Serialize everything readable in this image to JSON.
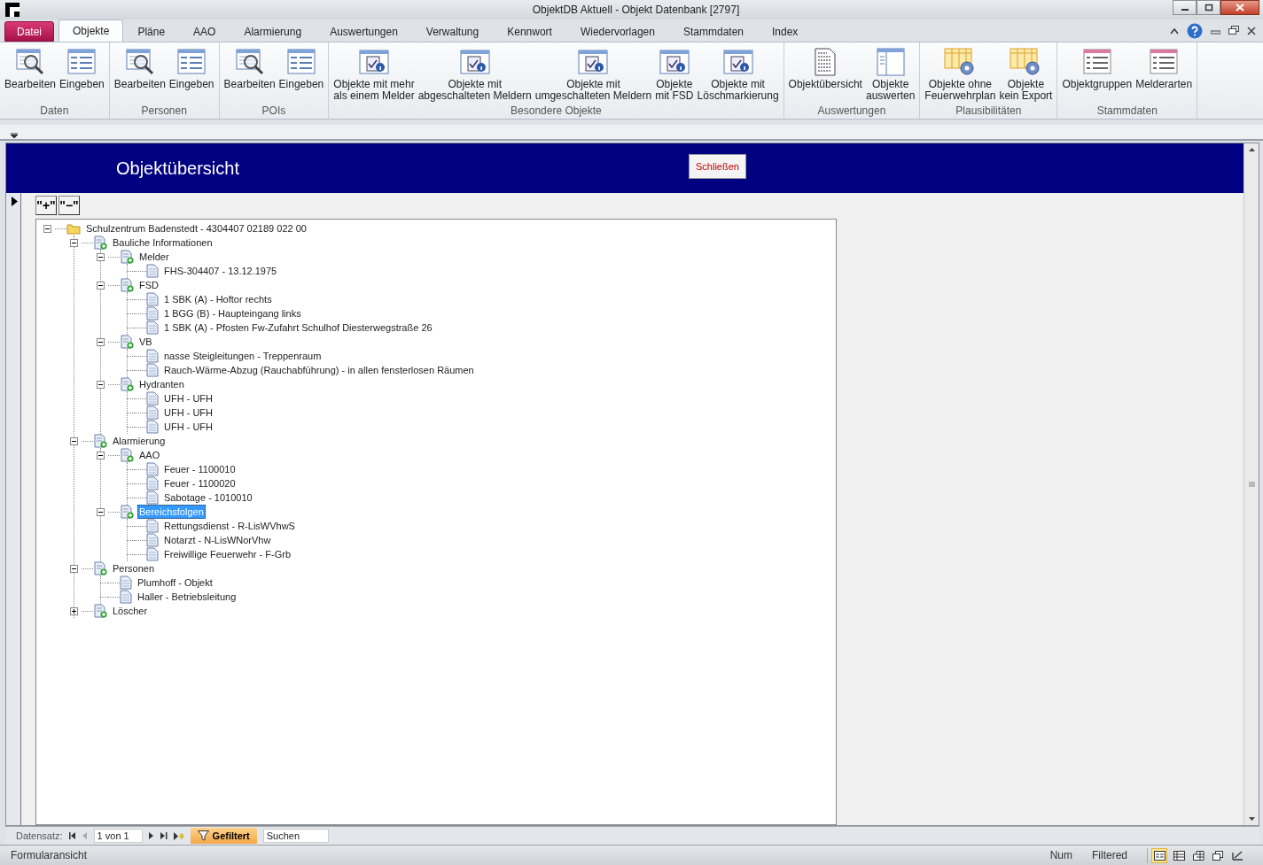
{
  "window": {
    "title": "ObjektDB Aktuell  -  Objekt Datenbank [2797]"
  },
  "file_tab": "Datei",
  "tabs": [
    {
      "label": "Objekte",
      "selected": true
    },
    {
      "label": "Pläne",
      "selected": false
    },
    {
      "label": "AAO",
      "selected": false
    },
    {
      "label": "Alarmierung",
      "selected": false
    },
    {
      "label": "Auswertungen",
      "selected": false
    },
    {
      "label": "Verwaltung",
      "selected": false
    },
    {
      "label": "Kennwort",
      "selected": false
    },
    {
      "label": "Wiedervorlagen",
      "selected": false
    },
    {
      "label": "Stammdaten",
      "selected": false
    },
    {
      "label": "Index",
      "selected": false
    }
  ],
  "ribbon_groups": [
    {
      "label": "Daten",
      "buttons": [
        {
          "label": "Bearbeiten",
          "kind": "search"
        },
        {
          "label": "Eingeben",
          "kind": "form"
        }
      ]
    },
    {
      "label": "Personen",
      "buttons": [
        {
          "label": "Bearbeiten",
          "kind": "search"
        },
        {
          "label": "Eingeben",
          "kind": "form"
        }
      ]
    },
    {
      "label": "POIs",
      "buttons": [
        {
          "label": "Bearbeiten",
          "kind": "search"
        },
        {
          "label": "Eingeben",
          "kind": "form"
        }
      ]
    },
    {
      "label": "Besondere Objekte",
      "buttons": [
        {
          "label": "Objekte mit mehr\nals einem Melder",
          "kind": "query"
        },
        {
          "label": "Objekte mit\nabgeschalteten Meldern",
          "kind": "query"
        },
        {
          "label": "Objekte mit\numgeschalteten Meldern",
          "kind": "query"
        },
        {
          "label": "Objekte\nmit FSD",
          "kind": "query"
        },
        {
          "label": "Objekte mit\nLöschmarkierung",
          "kind": "query"
        }
      ]
    },
    {
      "label": "Auswertungen",
      "buttons": [
        {
          "label": "Objektübersicht",
          "kind": "report"
        },
        {
          "label": "Objekte\nauswerten",
          "kind": "evaluate"
        }
      ]
    },
    {
      "label": "Plausibilitäten",
      "buttons": [
        {
          "label": "Objekte ohne\nFeuerwehrplan",
          "kind": "check"
        },
        {
          "label": "Objekte\nkein Export",
          "kind": "check"
        }
      ]
    },
    {
      "label": "Stammdaten",
      "buttons": [
        {
          "label": "Objektgruppen",
          "kind": "master"
        },
        {
          "label": "Melderarten",
          "kind": "master"
        }
      ]
    }
  ],
  "form": {
    "title": "Objektübersicht",
    "close_button": "Schließen",
    "expand_all_button": "\"+\"",
    "collapse_all_button": "\"−\""
  },
  "tree": [
    {
      "label": "Schulzentrum Badenstedt - 4304407 02189 022 00",
      "kind": "folder",
      "expanded": true,
      "selected": false,
      "children": [
        {
          "label": "Bauliche Informationen",
          "kind": "group",
          "expanded": true,
          "selected": false,
          "children": [
            {
              "label": "Melder",
              "kind": "group",
              "expanded": true,
              "selected": false,
              "children": [
                {
                  "label": "FHS-304407 - 13.12.1975",
                  "kind": "leaf",
                  "selected": false
                }
              ]
            },
            {
              "label": "FSD",
              "kind": "group",
              "expanded": true,
              "selected": false,
              "children": [
                {
                  "label": "1 SBK (A) - Hoftor rechts",
                  "kind": "leaf",
                  "selected": false
                },
                {
                  "label": "1 BGG (B) - Haupteingang links",
                  "kind": "leaf",
                  "selected": false
                },
                {
                  "label": "1 SBK (A) - Pfosten Fw-Zufahrt Schulhof Diesterwegstraße 26",
                  "kind": "leaf",
                  "selected": false
                }
              ]
            },
            {
              "label": "VB",
              "kind": "group",
              "expanded": true,
              "selected": false,
              "children": [
                {
                  "label": "nasse Steigleitungen - Treppenraum",
                  "kind": "leaf",
                  "selected": false
                },
                {
                  "label": "Rauch-Wärme-Abzug (Rauchabführung) - in allen fensterlosen Räumen",
                  "kind": "leaf",
                  "selected": false
                }
              ]
            },
            {
              "label": "Hydranten",
              "kind": "group",
              "expanded": true,
              "selected": false,
              "children": [
                {
                  "label": "UFH - UFH",
                  "kind": "leaf",
                  "selected": false
                },
                {
                  "label": "UFH - UFH",
                  "kind": "leaf",
                  "selected": false
                },
                {
                  "label": "UFH - UFH",
                  "kind": "leaf",
                  "selected": false
                }
              ]
            }
          ]
        },
        {
          "label": "Alarmierung",
          "kind": "group",
          "expanded": true,
          "selected": false,
          "children": [
            {
              "label": "AAO",
              "kind": "group",
              "expanded": true,
              "selected": false,
              "children": [
                {
                  "label": "Feuer - 1100010",
                  "kind": "leaf",
                  "selected": false
                },
                {
                  "label": "Feuer - 1100020",
                  "kind": "leaf",
                  "selected": false
                },
                {
                  "label": "Sabotage - 1010010",
                  "kind": "leaf",
                  "selected": false
                }
              ]
            },
            {
              "label": "Bereichsfolgen",
              "kind": "group",
              "expanded": true,
              "selected": true,
              "children": [
                {
                  "label": "Rettungsdienst - R-LisWVhwS",
                  "kind": "leaf",
                  "selected": false
                },
                {
                  "label": "Notarzt - N-LisWNorVhw",
                  "kind": "leaf",
                  "selected": false
                },
                {
                  "label": "Freiwillige Feuerwehr - F-Grb",
                  "kind": "leaf",
                  "selected": false
                }
              ]
            }
          ]
        },
        {
          "label": "Personen",
          "kind": "group",
          "expanded": true,
          "selected": false,
          "children": [
            {
              "label": "Plumhoff - Objekt",
              "kind": "leaf",
              "selected": false
            },
            {
              "label": "Haller - Betriebsleitung",
              "kind": "leaf",
              "selected": false
            }
          ]
        },
        {
          "label": "Löscher",
          "kind": "group",
          "expanded": false,
          "selected": false
        }
      ]
    }
  ],
  "navigation": {
    "label": "Datensatz:",
    "record": "1 von 1",
    "filter_button": "Gefiltert",
    "filter_active": true,
    "search": {
      "placeholder": "Suchen"
    }
  },
  "status_bar": {
    "view": "Formularansicht",
    "indicators": [
      "Num",
      "Filtered"
    ],
    "view_buttons": [
      {
        "kind": "form",
        "selected": true
      },
      {
        "kind": "datasheet",
        "selected": false
      },
      {
        "kind": "pivot",
        "selected": false
      },
      {
        "kind": "layout",
        "selected": false
      },
      {
        "kind": "design",
        "selected": false
      }
    ]
  }
}
